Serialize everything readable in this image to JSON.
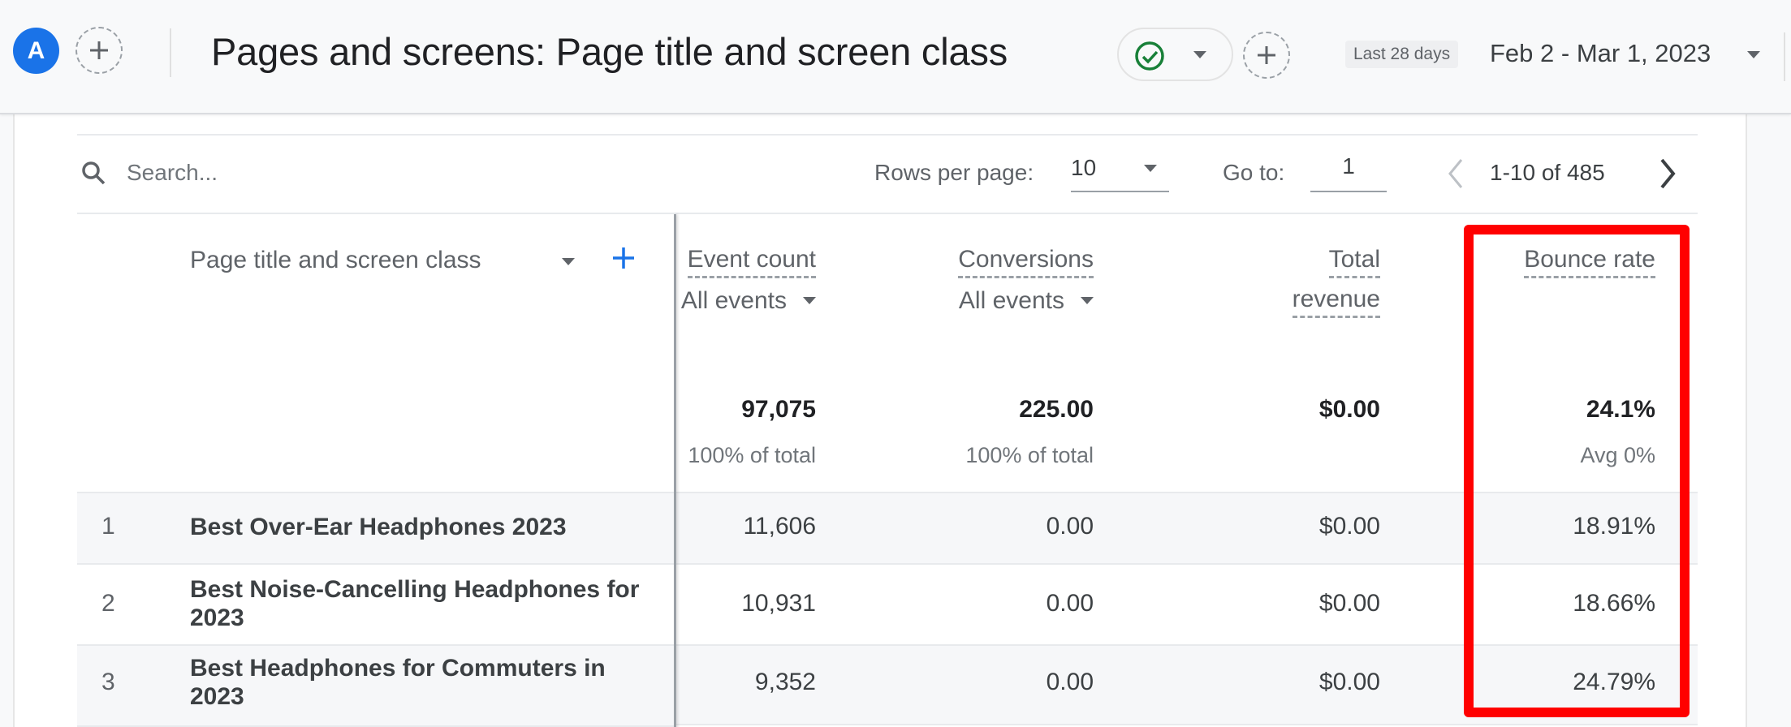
{
  "header": {
    "avatar_letter": "A",
    "title": "Pages and screens: Page title and screen class",
    "date_preset": "Last 28 days",
    "date_range": "Feb 2 - Mar 1, 2023"
  },
  "toolbar": {
    "search_placeholder": "Search...",
    "rows_per_page_label": "Rows per page:",
    "rows_per_page_value": "10",
    "goto_label": "Go to:",
    "goto_value": "1",
    "page_range": "1-10 of 485"
  },
  "table": {
    "dimension_header": "Page title and screen class",
    "columns": [
      {
        "metric": "Event count",
        "sub": "All events",
        "total": "97,075",
        "total_sub": "100% of total"
      },
      {
        "metric": "Conversions",
        "sub": "All events",
        "total": "225.00",
        "total_sub": "100% of total"
      },
      {
        "metric_line1": "Total",
        "metric_line2": "revenue",
        "total": "$0.00",
        "total_sub": ""
      },
      {
        "metric": "Bounce rate",
        "total": "24.1%",
        "total_sub": "Avg 0%"
      }
    ],
    "rows": [
      {
        "index": "1",
        "title": "Best Over-Ear Headphones 2023",
        "event_count": "11,606",
        "conversions": "0.00",
        "total_revenue": "$0.00",
        "bounce_rate": "18.91%"
      },
      {
        "index": "2",
        "title": "Best Noise-Cancelling Headphones for 2023",
        "event_count": "10,931",
        "conversions": "0.00",
        "total_revenue": "$0.00",
        "bounce_rate": "18.66%"
      },
      {
        "index": "3",
        "title": "Best Headphones for Commuters in 2023",
        "event_count": "9,352",
        "conversions": "0.00",
        "total_revenue": "$0.00",
        "bounce_rate": "24.79%"
      }
    ]
  },
  "annotation": {
    "highlight_color": "#ff0000",
    "highlighted_column": "Bounce rate"
  },
  "colors": {
    "accent_blue": "#1a73e8",
    "check_green": "#188038"
  }
}
